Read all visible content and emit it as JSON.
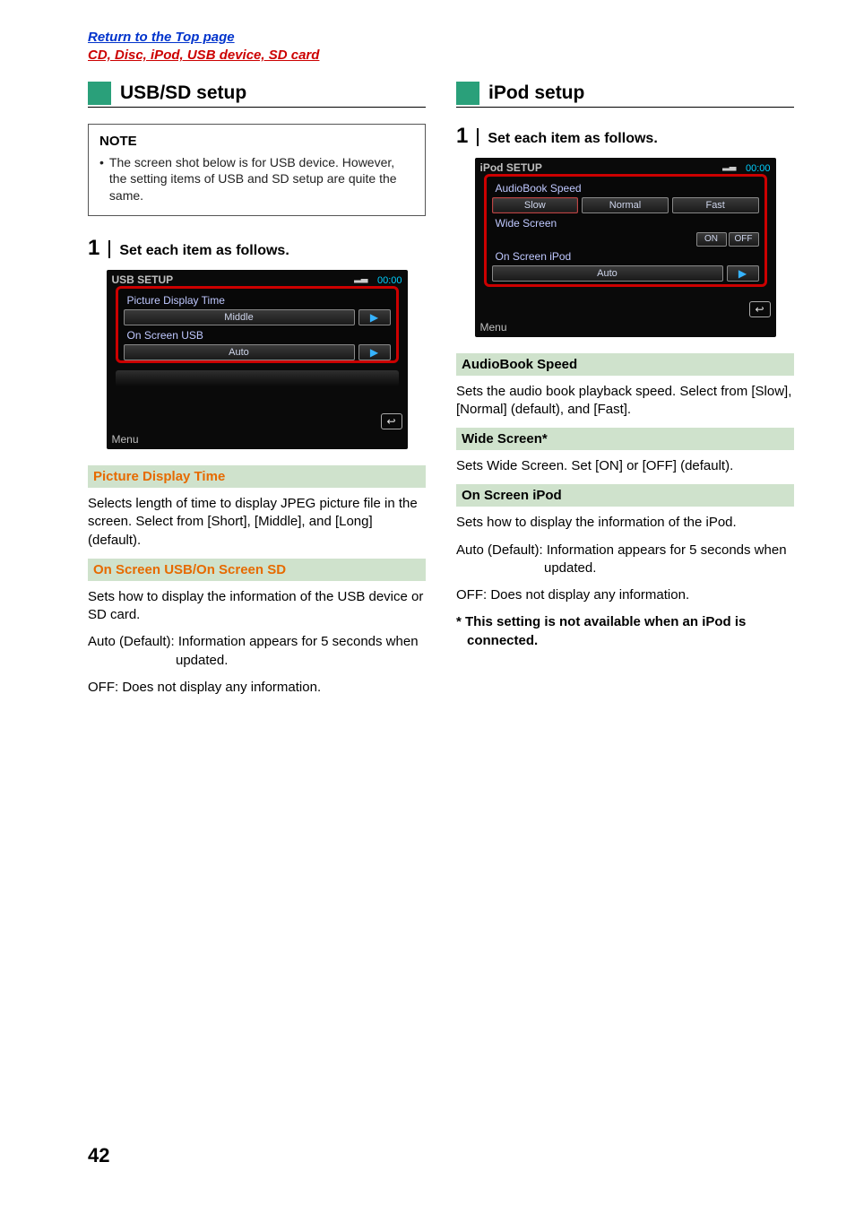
{
  "top_links": {
    "return": "Return to the Top page",
    "section": "CD, Disc, iPod, USB device, SD card"
  },
  "page_number": "42",
  "left": {
    "heading": "USB/SD setup",
    "note_title": "NOTE",
    "note_body": "The screen shot below is for USB device. However, the setting items of USB and SD setup are quite the same.",
    "step_num": "1",
    "step_text": "Set each item as follows.",
    "shot": {
      "title": "USB SETUP",
      "time": "00:00",
      "menu": "Menu",
      "opt1_label": "Picture Display Time",
      "opt1_value": "Middle",
      "opt2_label": "On Screen USB",
      "opt2_value": "Auto"
    },
    "params": [
      {
        "head": "Picture Display Time",
        "head_style": "orange",
        "body": "Selects length of time to display JPEG picture file in the screen. Select from [Short], [Middle], and [Long] (default)."
      },
      {
        "head": "On Screen USB/On Screen SD",
        "head_style": "orange",
        "body": "Sets how to display the information of the USB device or SD card.",
        "lines": [
          {
            "lead": "Auto (Default)",
            "rest": ": Information appears for 5 seconds when updated."
          },
          {
            "lead": "OFF",
            "rest": ": Does not display any information."
          }
        ]
      }
    ]
  },
  "right": {
    "heading": "iPod setup",
    "step_num": "1",
    "step_text": "Set each item as follows.",
    "shot": {
      "title": "iPod SETUP",
      "time": "00:00",
      "menu": "Menu",
      "r1_label": "AudioBook Speed",
      "r1_opts": [
        "Slow",
        "Normal",
        "Fast"
      ],
      "r2_label": "Wide Screen",
      "r2_on": "ON",
      "r2_off": "OFF",
      "r3_label": "On Screen iPod",
      "r3_value": "Auto"
    },
    "params": [
      {
        "head": "AudioBook Speed",
        "body": "Sets the audio book playback speed. Select from [Slow], [Normal] (default), and [Fast]."
      },
      {
        "head": "Wide Screen*",
        "body": "Sets Wide Screen. Set [ON] or [OFF] (default)."
      },
      {
        "head": "On Screen iPod",
        "body": "Sets how to display the information of the iPod.",
        "lines": [
          {
            "lead": "Auto (Default)",
            "rest": ": Information appears for 5 seconds when updated."
          },
          {
            "lead": "OFF",
            "rest": ": Does not display any information."
          }
        ]
      }
    ],
    "footnote": "* This setting is not available when an iPod is connected."
  }
}
